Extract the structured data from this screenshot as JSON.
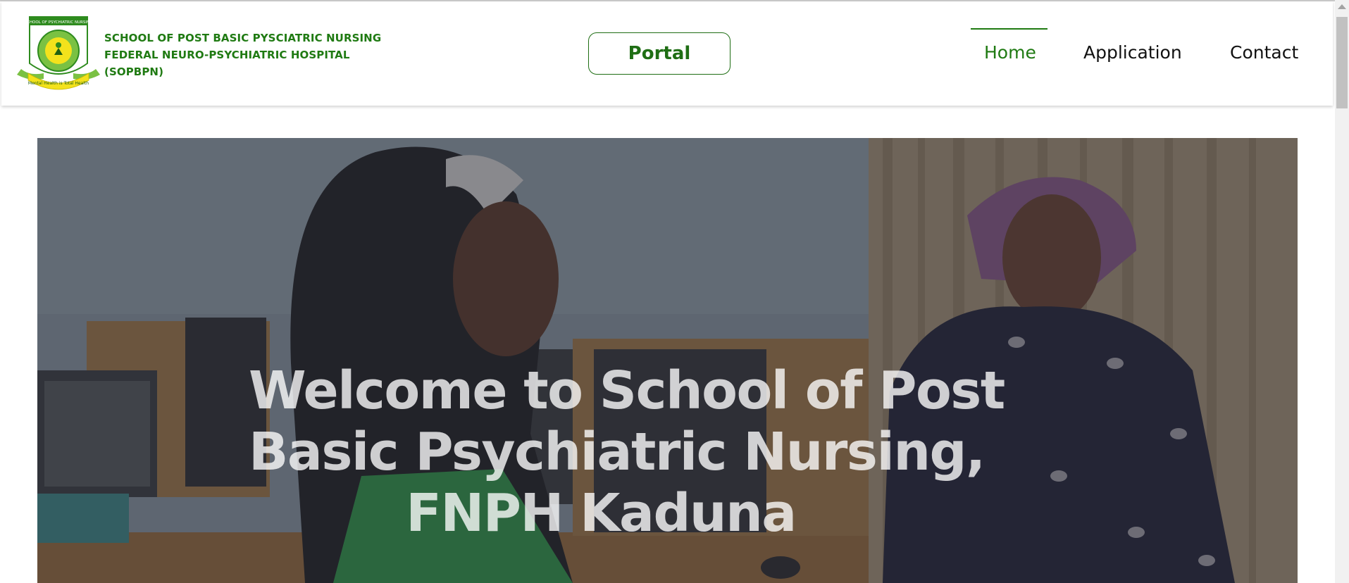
{
  "brand": {
    "line1": "SCHOOL OF POST BASIC PYSCIATRIC NURSING",
    "line2": "FEDERAL NEURO-PSYCHIATRIC HOSPITAL",
    "line3": "(SOPBPN)",
    "logo_top_text": "SCHOOL OF PSYCHIATRIC NURSING",
    "logo_motto": "Mental Health is Total Health"
  },
  "header": {
    "portal_label": "Portal",
    "nav": [
      {
        "label": "Home",
        "active": true
      },
      {
        "label": "Application",
        "active": false
      },
      {
        "label": "Contact",
        "active": false
      }
    ]
  },
  "hero": {
    "line1": "Welcome to School of Post",
    "line2": "Basic Psychiatric Nursing,",
    "line3": "FNPH Kaduna"
  },
  "colors": {
    "brand_green": "#1f7a12",
    "nav_text": "#111111",
    "hero_overlay": "rgba(40,40,48,0.45)"
  }
}
